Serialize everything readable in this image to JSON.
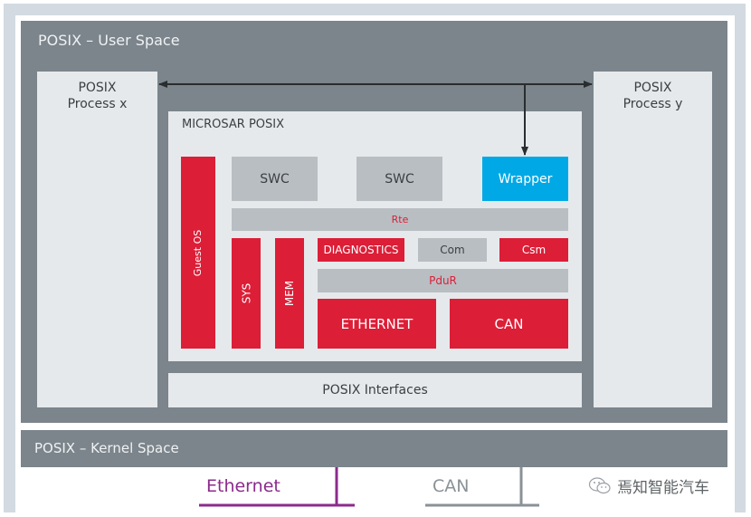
{
  "diagram": {
    "user_space": {
      "title": "POSIX – User Space",
      "process_x": {
        "line1": "POSIX",
        "line2": "Process x"
      },
      "process_y": {
        "line1": "POSIX",
        "line2": "Process y"
      },
      "microsar": {
        "title": "MICROSAR POSIX",
        "guest_os": "Guest OS",
        "swc_1": "SWC",
        "swc_2": "SWC",
        "wrapper": "Wrapper",
        "rte": "Rte",
        "sys": "SYS",
        "mem": "MEM",
        "diagnostics": "DIAGNOSTICS",
        "com": "Com",
        "csm": "Csm",
        "pdur": "PduR",
        "ethernet": "ETHERNET",
        "can": "CAN"
      },
      "posix_interfaces": "POSIX Interfaces"
    },
    "kernel_space": {
      "title": "POSIX – Kernel Space"
    },
    "buses": {
      "ethernet": "Ethernet",
      "can": "CAN"
    },
    "colors": {
      "autosar_red": "#dc1e37",
      "wrapper_blue": "#00a9e6",
      "space_gray": "#7b858b",
      "ethernet_purple": "#8c2a8c",
      "can_gray": "#8a9297"
    },
    "watermark": {
      "icon": "wechat-icon",
      "text": "焉知智能汽车"
    }
  }
}
